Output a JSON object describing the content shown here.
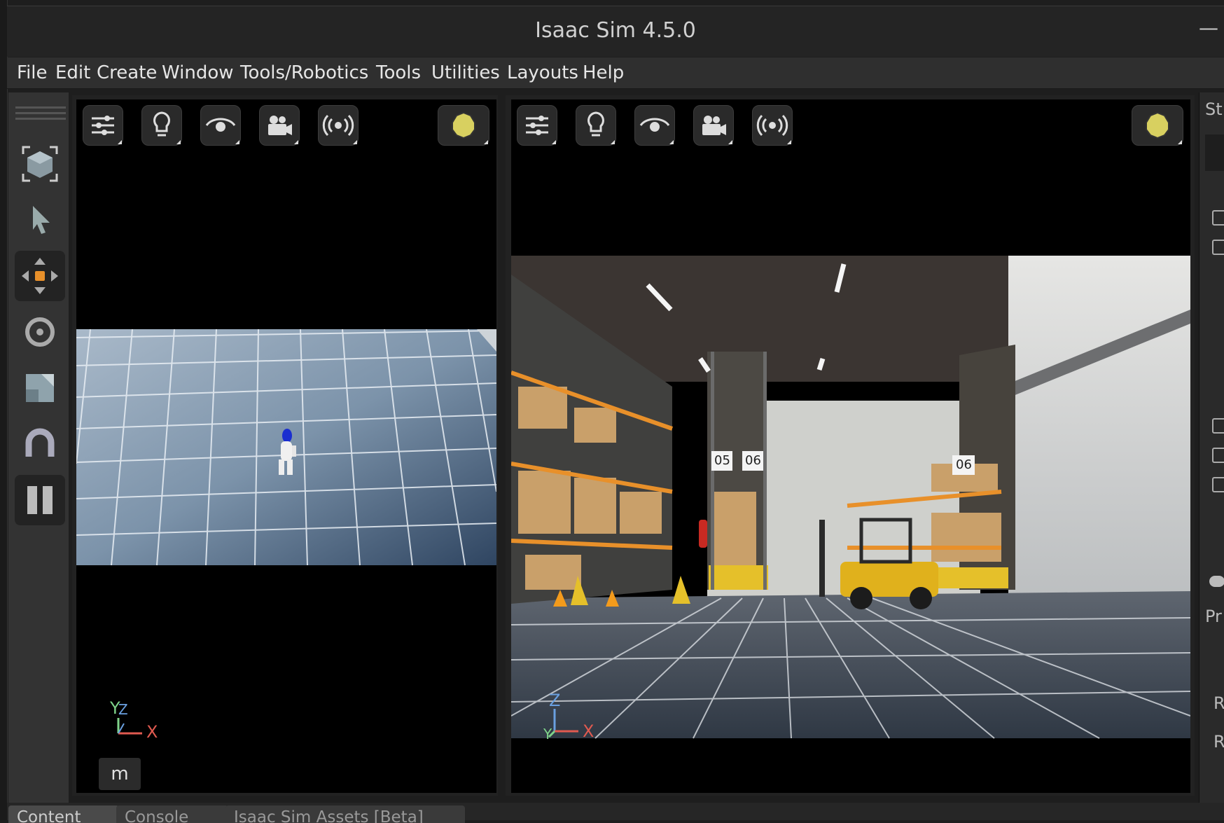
{
  "app": {
    "title": "Isaac Sim 4.5.0",
    "minimize_glyph": "—"
  },
  "menu": [
    "File",
    "Edit",
    "Create",
    "Window",
    "Tools/Robotics",
    "Tools",
    "Utilities",
    "Layouts",
    "Help"
  ],
  "toolbar": {
    "tools": [
      "frame-selection-icon",
      "select-arrow-icon",
      "move-icon",
      "rotate-icon",
      "scale-icon",
      "snap-magnet-icon",
      "pause-icon"
    ],
    "active_tool": "move-icon"
  },
  "viewport_buttons": [
    "settings-sliders-icon",
    "lightbulb-icon",
    "eye-icon",
    "camera-icon",
    "render-wave-icon",
    "sun-icon"
  ],
  "viewport1": {
    "axis_labels": [
      "Y",
      "Z",
      "X"
    ],
    "unit": "m"
  },
  "viewport2": {
    "axis_labels": [
      "Z",
      "Y",
      "X"
    ],
    "rack_labels": [
      "05",
      "06",
      "06"
    ]
  },
  "right_panel": {
    "labels": [
      "St",
      "Pr",
      "R",
      "R"
    ]
  },
  "bottom_tabs": [
    "Content",
    "Console",
    "Isaac Sim Assets [Beta]"
  ],
  "colors": {
    "accent_orange": "#e8902a",
    "sun_yellow": "#d8d060",
    "axis_x": "#e05a50",
    "axis_y": "#7fd38a",
    "axis_z": "#6aa0e0"
  }
}
